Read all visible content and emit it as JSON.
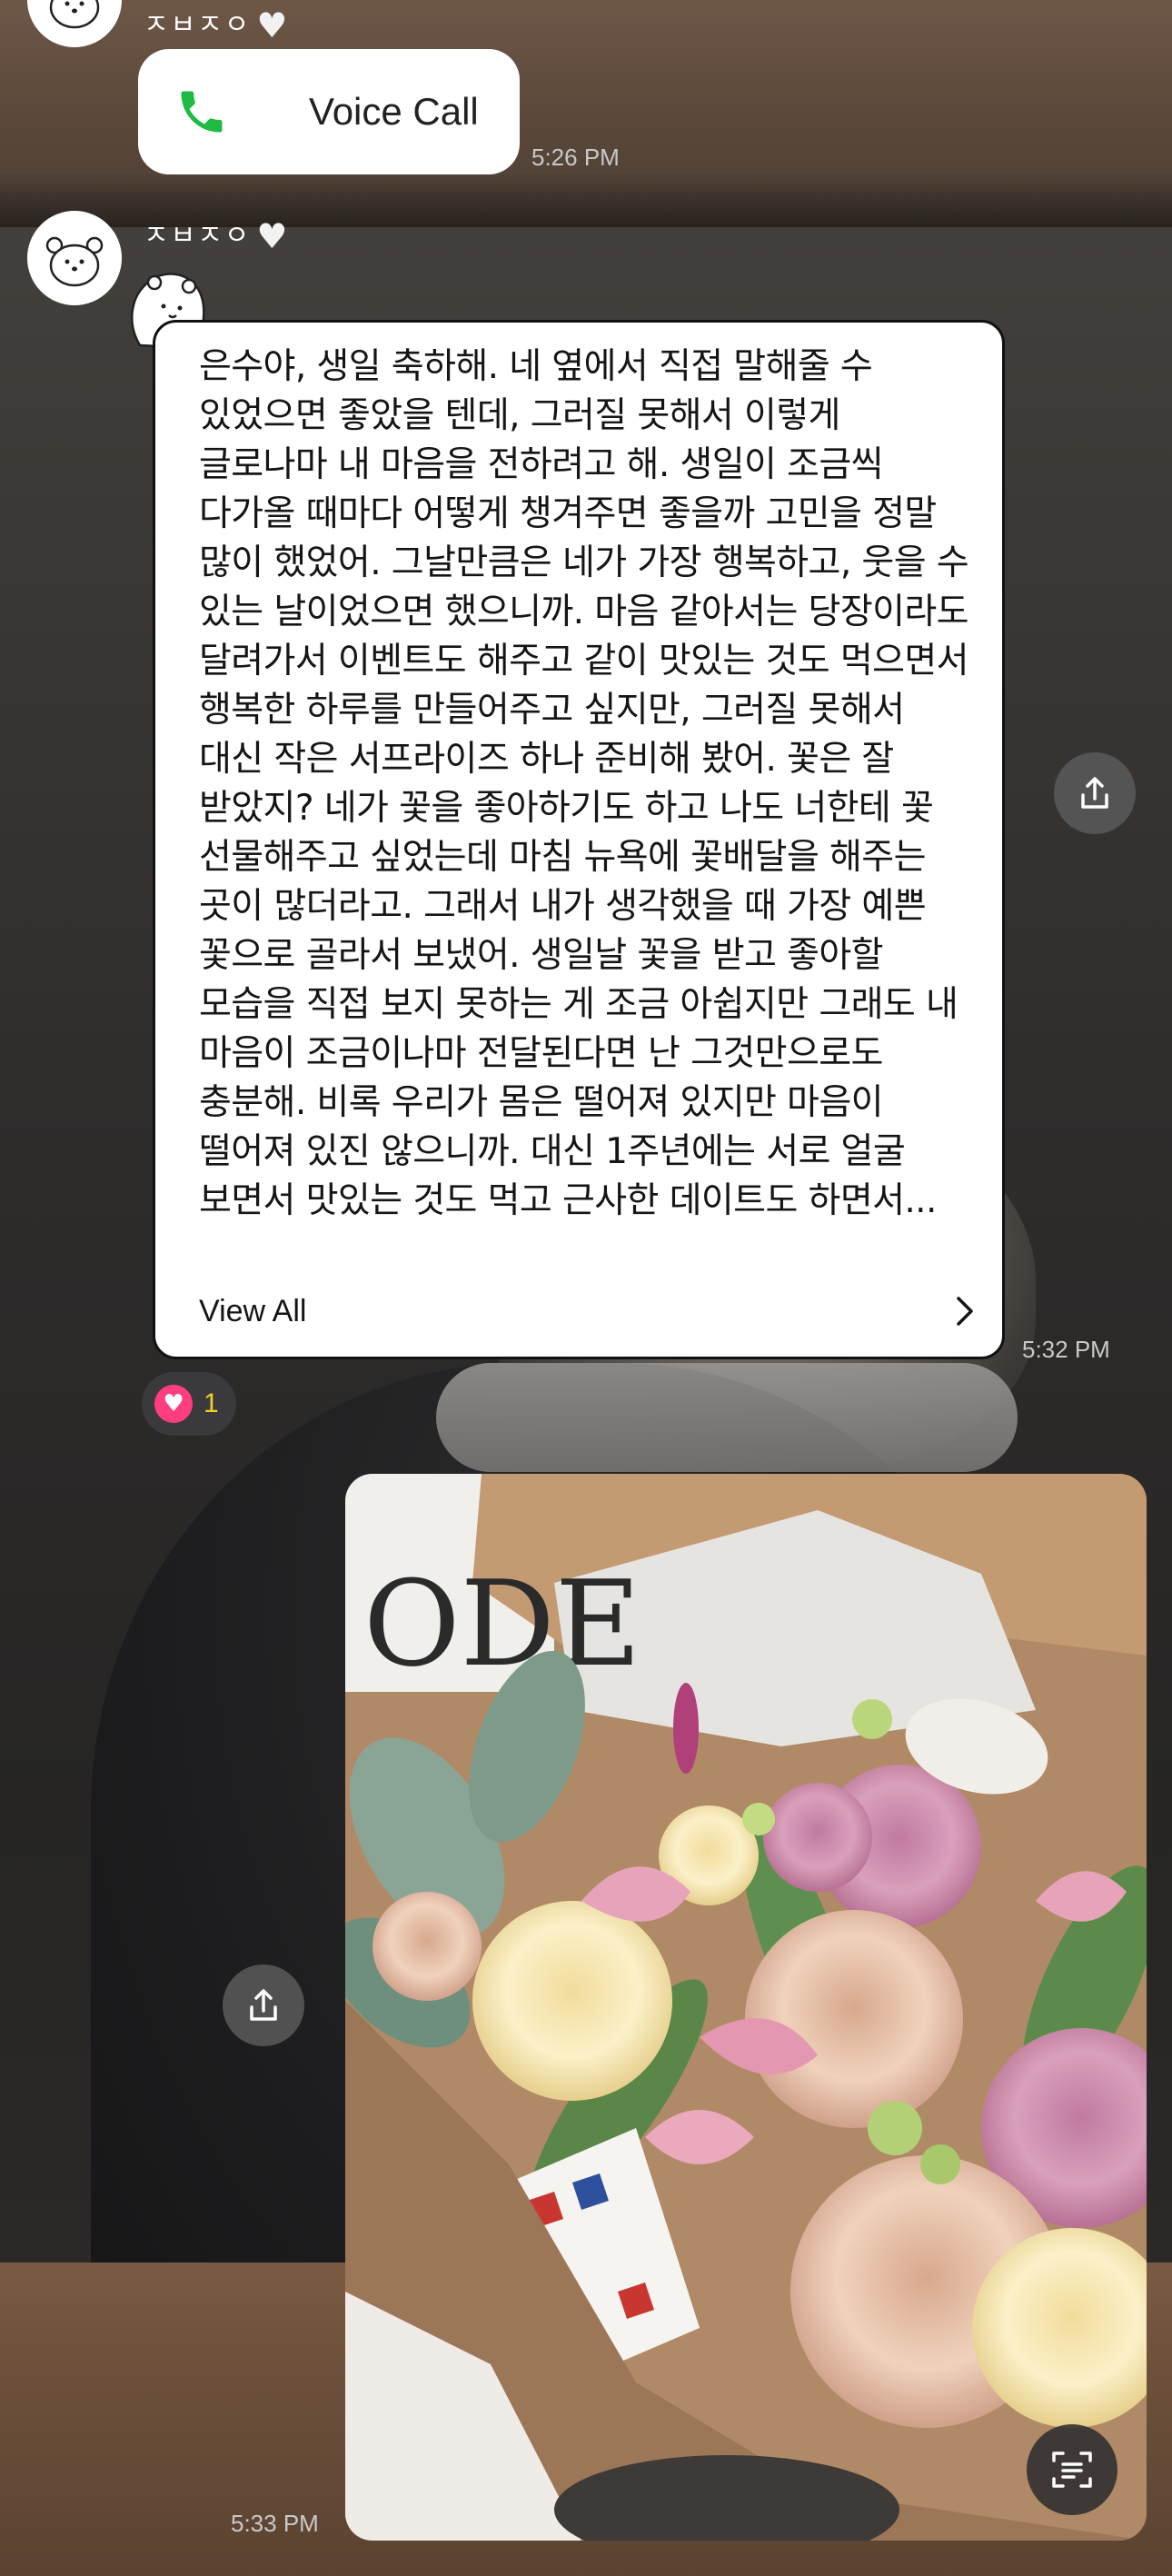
{
  "messages": {
    "first": {
      "sender": "ㅈㅂㅈㅇ",
      "voice_call_label": "Voice Call",
      "time": "5:26 PM"
    },
    "second": {
      "sender": "ㅈㅂㅈㅇ",
      "letter_text": "은수야, 생일 축하해. 네 옆에서 직접 말해줄 수 있었으면 좋았을 텐데, 그러질 못해서 이렇게 글로나마 내 마음을 전하려고 해. 생일이 조금씩 다가올 때마다 어떻게 챙겨주면 좋을까 고민을 정말 많이 했었어. 그날만큼은 네가 가장 행복하고, 웃을 수 있는 날이었으면 했으니까. 마음 같아서는 당장이라도 달려가서 이벤트도 해주고 같이 맛있는 것도 먹으면서 행복한 하루를 만들어주고 싶지만, 그러질 못해서 대신 작은 서프라이즈 하나 준비해 봤어. 꽃은 잘 받았지? 네가 꽃을 좋아하기도 하고 나도 너한테 꽃 선물해주고 싶었는데 마침 뉴욕에 꽃배달을 해주는 곳이 많더라고. 그래서 내가 생각했을 때 가장 예쁜 꽃으로 골라서 보냈어. 생일날 꽃을 받고 좋아할 모습을 직접 보지 못하는 게 조금 아쉽지만 그래도 내 마음이 조금이나마 전달된다면 난 그것만으로도 충분해. 비록 우리가 몸은 떨어져 있지만 마음이 떨어져 있진 않으니까. 대신 1주년에는 서로 얼굴 보면서 맛있는 것도 먹고 근사한 데이트도 하면서...",
      "view_all_label": "View All",
      "time": "5:32 PM",
      "reaction_count": "1"
    },
    "third": {
      "photo_text": "ODE",
      "time": "5:33 PM"
    }
  },
  "colors": {
    "bubble_bg": "#ffffff",
    "phone_icon": "#1fbb45",
    "reaction_heart": "#ff3d7f",
    "reaction_count": "#f1d02a"
  },
  "icons": [
    "heart-icon",
    "phone-icon",
    "chevron-right-icon",
    "share-icon",
    "scan-text-icon"
  ]
}
